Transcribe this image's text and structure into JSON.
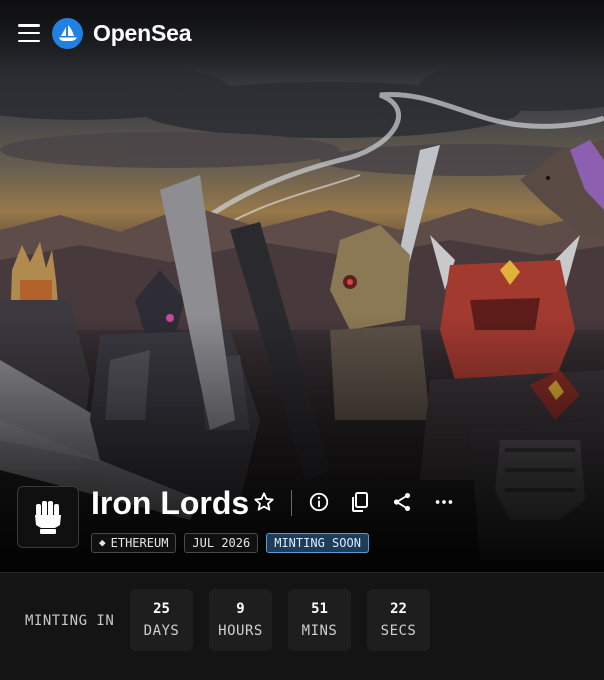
{
  "header": {
    "brand": "OpenSea",
    "menu_icon": "hamburger-menu-icon",
    "logo_icon": "opensea-sailboat-icon"
  },
  "collection": {
    "name": "Iron Lords",
    "avatar_icon": "gauntlet-fist-icon",
    "badges": {
      "chain": "ETHEREUM",
      "date": "JUL 2026",
      "status": "MINTING SOON"
    },
    "actions": [
      "star-icon",
      "info-icon",
      "copy-icon",
      "share-icon",
      "more-icon"
    ]
  },
  "countdown": {
    "label": "MINTING IN",
    "units": [
      {
        "value": "25",
        "unit": "DAYS"
      },
      {
        "value": "9",
        "unit": "HOURS"
      },
      {
        "value": "51",
        "unit": "MINS"
      },
      {
        "value": "22",
        "unit": "SECS"
      }
    ]
  },
  "colors": {
    "brand_blue": "#2081e2",
    "background": "#141414",
    "status_badge": "#5a9ad6"
  }
}
